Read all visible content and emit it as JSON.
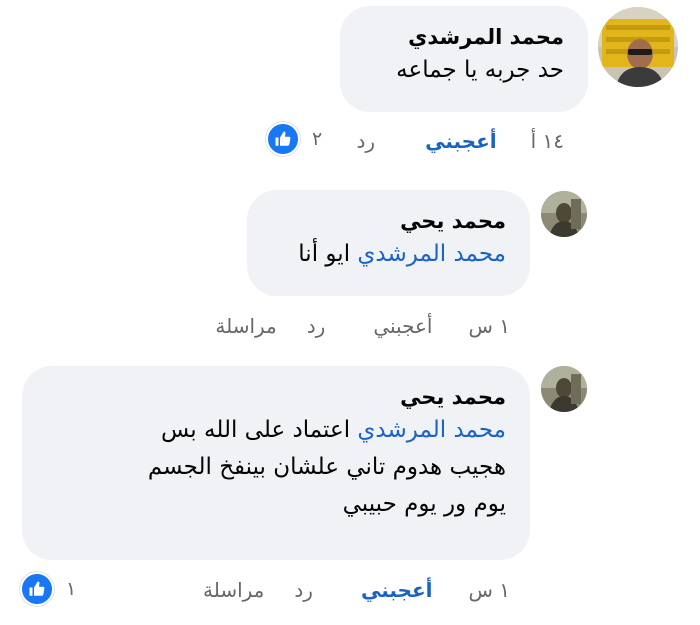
{
  "comments": [
    {
      "author": "محمد المرشدي",
      "text": "حد جربه يا جماعه",
      "time": "١٤ أ",
      "like_label": "أعجبني",
      "reply_label": "رد",
      "reaction_count": "٢"
    },
    {
      "author": "محمد يحي",
      "mention": "محمد المرشدي",
      "text": "ايو أنا",
      "time": "١ س",
      "like_label": "أعجبني",
      "reply_label": "رد",
      "message_label": "مراسلة"
    },
    {
      "author": "محمد يحي",
      "mention": "محمد المرشدي",
      "text_line1": "اعتماد على الله بس",
      "text_line2": "هجيب هدوم تاني علشان بينفخ الجسم",
      "text_line3": "يوم ور يوم حبيبي",
      "time": "١ س",
      "like_label": "أعجبني",
      "reply_label": "رد",
      "message_label": "مراسلة",
      "reaction_count": "١"
    }
  ],
  "colors": {
    "bubble": "#f0f2f5",
    "mention": "#1b62c7",
    "meta": "#65676b",
    "like_badge": "#1877f2"
  },
  "icons": {
    "reaction": "thumbs-up-icon"
  }
}
